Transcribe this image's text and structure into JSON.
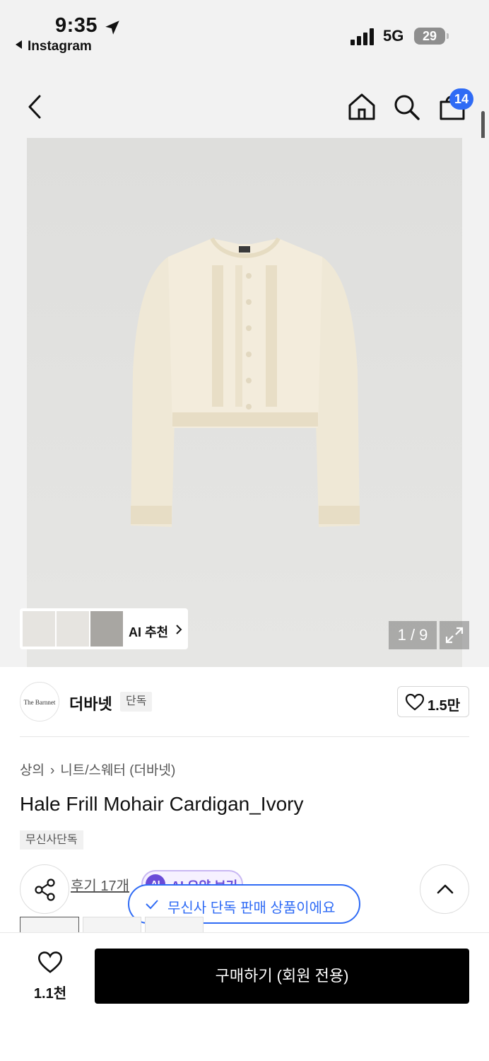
{
  "status_bar": {
    "time": "9:35",
    "back_app": "Instagram",
    "network": "5G",
    "battery": "29"
  },
  "header": {
    "cart_count": "14"
  },
  "gallery": {
    "ai_recommend_label": "AI 추천",
    "page_counter": "1 / 9"
  },
  "brand": {
    "logo_text": "The Barnnet",
    "name": "더바넷",
    "tag": "단독",
    "like_count": "1.5만"
  },
  "product": {
    "breadcrumb": [
      "상의",
      "니트/스웨터 (더바넷)"
    ],
    "title": "Hale Frill Mohair Cardigan_Ivory",
    "exclusive_tag": "무신사단독",
    "review_link": "후기 17개",
    "ai_summary_icon": "AI",
    "ai_summary_label": "AI 요약 보기"
  },
  "toast": {
    "message": "무신사 단독 판매 상품이에요"
  },
  "bottom_bar": {
    "like_count": "1.1천",
    "buy_label": "구매하기 (회원 전용)"
  },
  "colors": {
    "accent_blue": "#2f6bf5",
    "ai_purple": "#6a4bd8",
    "cardigan": "#f3ecdc"
  }
}
